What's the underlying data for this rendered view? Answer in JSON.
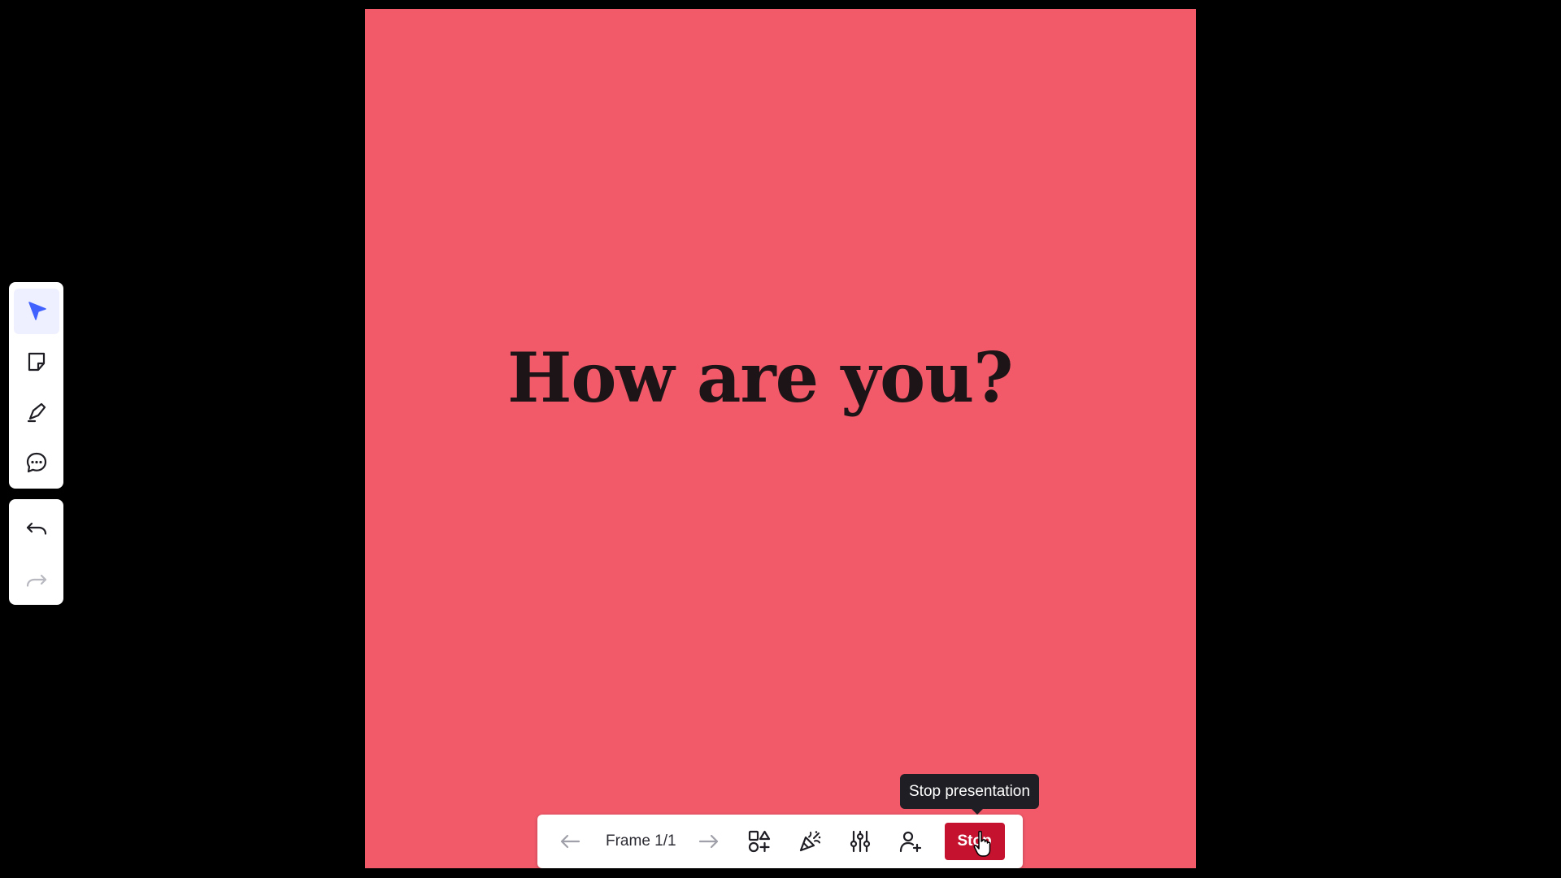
{
  "slide": {
    "title": "How are you?",
    "background_color": "#f25a6a"
  },
  "left_toolbar": {
    "tools": [
      {
        "icon": "select-cursor-icon",
        "active": true
      },
      {
        "icon": "sticky-note-icon",
        "active": false
      },
      {
        "icon": "pen-icon",
        "active": false
      },
      {
        "icon": "comment-icon",
        "active": false
      }
    ],
    "history": [
      {
        "icon": "undo-icon",
        "enabled": true
      },
      {
        "icon": "redo-icon",
        "enabled": false
      }
    ],
    "accent_color": "#4262ff"
  },
  "presentation_bar": {
    "frame_label": "Frame 1/1",
    "icons": [
      "arrow-left-icon",
      "arrow-right-icon",
      "shapes-icon",
      "celebrate-icon",
      "settings-sliders-icon",
      "invite-user-icon"
    ],
    "stop_label": "Stop",
    "stop_color": "#c4122f"
  },
  "tooltip": {
    "text": "Stop presentation"
  }
}
